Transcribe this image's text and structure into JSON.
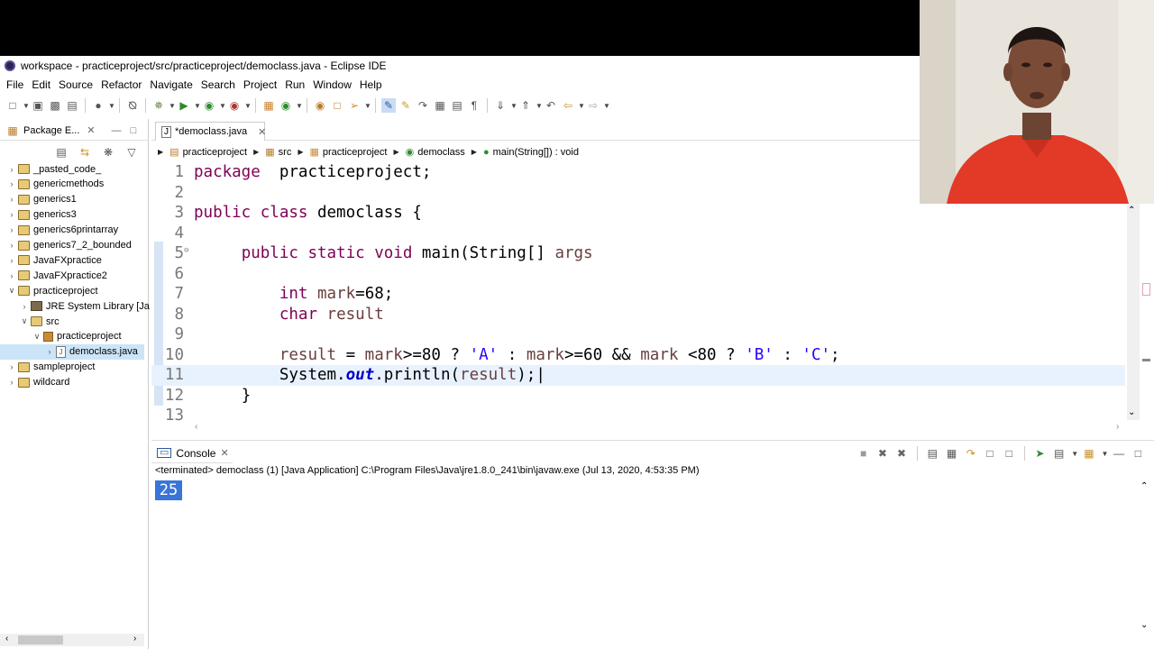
{
  "window": {
    "title": "workspace - practiceproject/src/practiceproject/democlass.java - Eclipse IDE"
  },
  "menu": [
    "File",
    "Edit",
    "Source",
    "Refactor",
    "Navigate",
    "Search",
    "Project",
    "Run",
    "Window",
    "Help"
  ],
  "package_explorer": {
    "tab_label": "Package E...",
    "items": [
      {
        "label": "_pasted_code_",
        "indent": 0,
        "twisty": ">",
        "icon": "project"
      },
      {
        "label": "genericmethods",
        "indent": 0,
        "twisty": ">",
        "icon": "project"
      },
      {
        "label": "generics1",
        "indent": 0,
        "twisty": ">",
        "icon": "project"
      },
      {
        "label": "generics3",
        "indent": 0,
        "twisty": ">",
        "icon": "project"
      },
      {
        "label": "generics6printarray",
        "indent": 0,
        "twisty": ">",
        "icon": "project"
      },
      {
        "label": "generics7_2_bounded",
        "indent": 0,
        "twisty": ">",
        "icon": "project"
      },
      {
        "label": "JavaFXpractice",
        "indent": 0,
        "twisty": ">",
        "icon": "project"
      },
      {
        "label": "JavaFXpractice2",
        "indent": 0,
        "twisty": ">",
        "icon": "project"
      },
      {
        "label": "practiceproject",
        "indent": 0,
        "twisty": "v",
        "icon": "project"
      },
      {
        "label": "JRE System Library [Ja",
        "indent": 1,
        "twisty": ">",
        "icon": "library"
      },
      {
        "label": "src",
        "indent": 1,
        "twisty": "v",
        "icon": "project"
      },
      {
        "label": "practiceproject",
        "indent": 2,
        "twisty": "v",
        "icon": "package"
      },
      {
        "label": "democlass.java",
        "indent": 3,
        "twisty": ">",
        "icon": "java-file",
        "selected": true
      },
      {
        "label": "sampleproject",
        "indent": 0,
        "twisty": ">",
        "icon": "project"
      },
      {
        "label": "wildcard",
        "indent": 0,
        "twisty": ">",
        "icon": "project"
      }
    ]
  },
  "editor": {
    "tab_label": "*democlass.java",
    "breadcrumb": [
      "practiceproject",
      "src",
      "practiceproject",
      "democlass",
      "main(String[]) : void"
    ],
    "current_line": 11,
    "lines": [
      {
        "n": "1",
        "tokens": [
          [
            "kw",
            "package"
          ],
          [
            "",
            "  practiceproject;"
          ]
        ]
      },
      {
        "n": "2",
        "tokens": []
      },
      {
        "n": "3",
        "tokens": [
          [
            "kw",
            "public"
          ],
          [
            "",
            " "
          ],
          [
            "kw",
            "class"
          ],
          [
            "",
            " democlass {"
          ]
        ]
      },
      {
        "n": "4",
        "tokens": []
      },
      {
        "n": "5",
        "tokens": [
          [
            "",
            " "
          ],
          [
            "kw",
            "public"
          ],
          [
            "",
            " "
          ],
          [
            "kw",
            "static"
          ],
          [
            "",
            " "
          ],
          [
            "kw",
            "void"
          ],
          [
            "",
            " main(String[] "
          ],
          [
            "var",
            "args"
          ],
          [
            ") {"
          ]
        ]
      },
      {
        "n": "6",
        "tokens": []
      },
      {
        "n": "7",
        "tokens": [
          [
            "",
            " "
          ],
          [
            "kw",
            "int"
          ],
          [
            "",
            " "
          ],
          [
            "var",
            "mark"
          ],
          [
            "",
            "=68;"
          ]
        ]
      },
      {
        "n": "8",
        "tokens": [
          [
            "",
            " "
          ],
          [
            "kw",
            "char"
          ],
          [
            "",
            " "
          ],
          [
            "var",
            "result"
          ],
          [
            ";"
          ]
        ]
      },
      {
        "n": "9",
        "tokens": []
      },
      {
        "n": "10",
        "tokens": [
          [
            "",
            " "
          ],
          [
            "var",
            "result"
          ],
          [
            "",
            " = "
          ],
          [
            "var",
            "mark"
          ],
          [
            "",
            ">=80 ? "
          ],
          [
            "str",
            "'A'"
          ],
          [
            "",
            " : "
          ],
          [
            "var",
            "mark"
          ],
          [
            "",
            ">=60 && "
          ],
          [
            "var",
            "mark"
          ],
          [
            "",
            " <80 ? "
          ],
          [
            "str",
            "'B'"
          ],
          [
            "",
            " : "
          ],
          [
            "str",
            "'C'"
          ],
          [
            "",
            ";"
          ]
        ]
      },
      {
        "n": "11",
        "tokens": [
          [
            "",
            " System."
          ],
          [
            "fld",
            "out"
          ],
          [
            "",
            ".println("
          ],
          [
            "var",
            "result"
          ],
          [
            "",
            ");"
          ]
        ]
      },
      {
        "n": "12",
        "tokens": [
          [
            "",
            " }"
          ]
        ]
      },
      {
        "n": "13",
        "tokens": []
      }
    ]
  },
  "console": {
    "tab_label": "Console",
    "status": "<terminated> democlass (1) [Java Application] C:\\Program Files\\Java\\jre1.8.0_241\\bin\\javaw.exe (Jul 13, 2020, 4:53:35 PM)",
    "output": "25"
  }
}
